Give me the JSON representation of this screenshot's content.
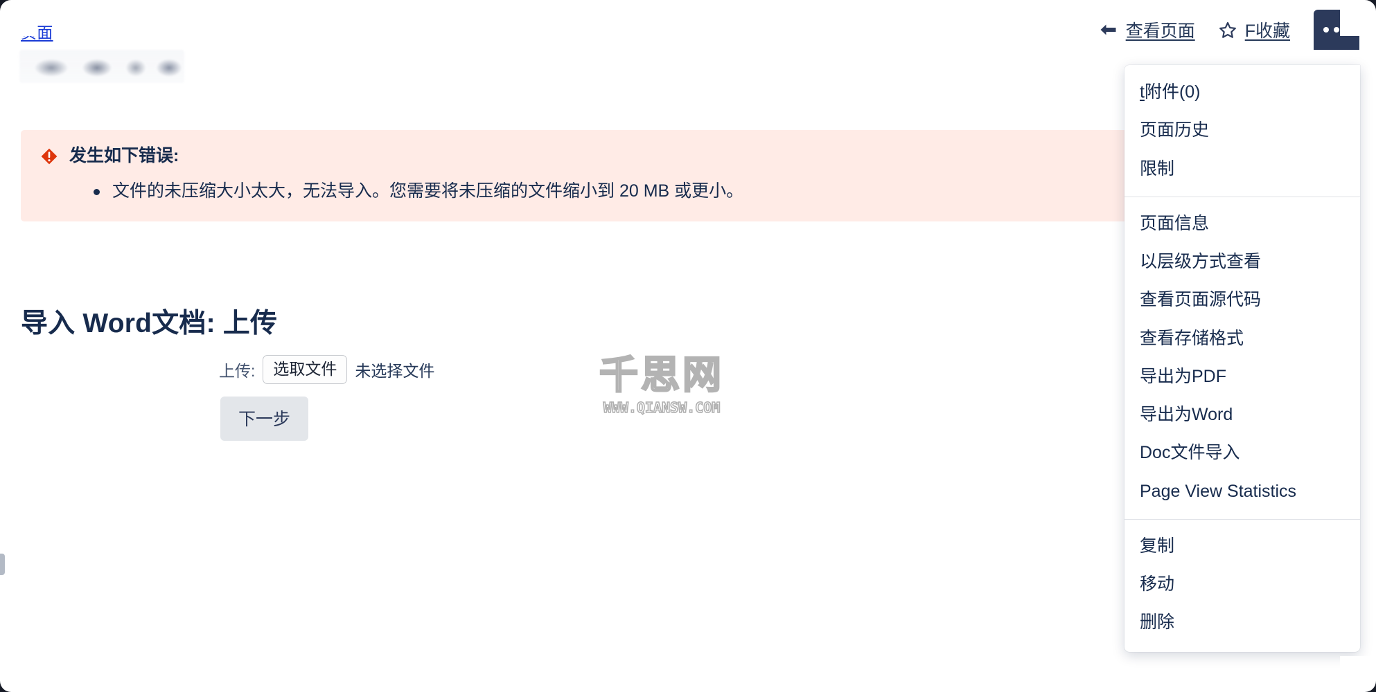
{
  "header": {
    "breadcrumb": "页面",
    "page_title_redacted": true,
    "toolbar": {
      "view_page": {
        "label": "查看页面",
        "icon": "arrow-left-icon"
      },
      "favorite": {
        "accesskey": "F",
        "label": "收藏",
        "icon": "star-icon"
      },
      "more": {
        "label": "...",
        "icon": "ellipsis-icon"
      }
    }
  },
  "error": {
    "icon": "error-diamond-icon",
    "title": "发生如下错误:",
    "items": [
      "文件的未压缩大小太大，无法导入。您需要将未压缩的文件缩小到 20 MB 或更小。"
    ]
  },
  "form": {
    "heading": "导入 Word文档: 上传",
    "upload_label": "上传:",
    "file_button_label": "选取文件",
    "file_status": "未选择文件",
    "next_button_label": "下一步"
  },
  "watermark": {
    "text_cn": "千思网",
    "text_url": "WWW.QIANSW.COM"
  },
  "menu": {
    "groups": [
      {
        "items": [
          {
            "accesskey": "t",
            "label": "附件(0)"
          },
          {
            "accesskey": "",
            "label": "页面历史"
          },
          {
            "accesskey": "",
            "label": "限制"
          }
        ]
      },
      {
        "items": [
          {
            "accesskey": "",
            "label": "页面信息"
          },
          {
            "accesskey": "",
            "label": "以层级方式查看"
          },
          {
            "accesskey": "",
            "label": "查看页面源代码"
          },
          {
            "accesskey": "",
            "label": "查看存储格式"
          },
          {
            "accesskey": "",
            "label": "导出为PDF"
          },
          {
            "accesskey": "",
            "label": "导出为Word"
          },
          {
            "accesskey": "",
            "label": "Doc文件导入"
          },
          {
            "accesskey": "",
            "label": "Page View Statistics"
          }
        ]
      },
      {
        "items": [
          {
            "accesskey": "",
            "label": "复制"
          },
          {
            "accesskey": "",
            "label": "移动"
          },
          {
            "accesskey": "",
            "label": "删除"
          }
        ]
      }
    ]
  },
  "colors": {
    "link": "#1a3bd6",
    "text": "#172b4d",
    "error_bg": "#ffebe6",
    "error_icon": "#de350b",
    "accent_dark": "#2c3a5b",
    "button_bg": "#e3e6ea"
  }
}
